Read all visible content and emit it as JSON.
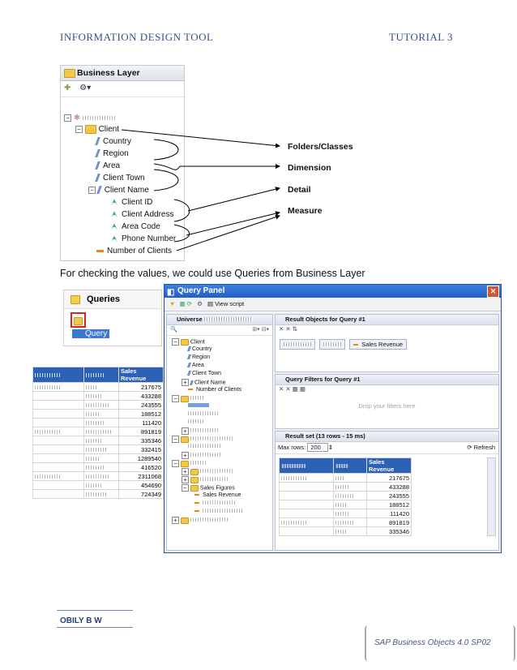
{
  "header": {
    "left": "INFORMATION DESIGN TOOL",
    "right": "TUTORIAL 3"
  },
  "business_layer": {
    "title": "Business Layer",
    "tree": [
      {
        "label": "Client",
        "kind": "folder"
      },
      {
        "label": "Country",
        "kind": "dimension"
      },
      {
        "label": "Region",
        "kind": "dimension"
      },
      {
        "label": "Area",
        "kind": "dimension"
      },
      {
        "label": "Client Town",
        "kind": "dimension"
      },
      {
        "label": "Client Name",
        "kind": "dimension"
      },
      {
        "label": "Client ID",
        "kind": "detail"
      },
      {
        "label": "Client Address",
        "kind": "detail"
      },
      {
        "label": "Area Code",
        "kind": "detail"
      },
      {
        "label": "Phone Number",
        "kind": "detail"
      },
      {
        "label": "Number of Clients",
        "kind": "measure"
      }
    ]
  },
  "callouts": {
    "folders": "Folders/Classes",
    "dimension": "Dimension",
    "detail": "Detail",
    "measure": "Measure"
  },
  "body_text": "For checking the values, we could use Queries from Business Layer",
  "queries_panel": {
    "title": "Queries",
    "item": "Query"
  },
  "left_table": {
    "header": "Sales Revenue",
    "values": [
      "217675",
      "433288",
      "243555",
      "188512",
      "111420",
      "891819",
      "335346",
      "332415",
      "1289540",
      "416520",
      "2311068",
      "454690",
      "724349"
    ]
  },
  "query_panel": {
    "title": "Query Panel",
    "view_script": "View script",
    "universe_label": "Universe",
    "tree": [
      "Client",
      "Country",
      "Region",
      "Area",
      "Client Town",
      "Client Name",
      "Number of Clients",
      "Sales Figures",
      "Sales Revenue"
    ],
    "result_objects_title": "Result Objects for Query #1",
    "result_chip": "Sales Revenue",
    "filters_title": "Query Filters for Query #1",
    "filters_placeholder": "Drop your filters here",
    "result_set_title": "Result set (13 rows - 15 ms)",
    "max_rows_label": "Max rows:",
    "max_rows_value": "200",
    "refresh": "Refresh",
    "result_header": "Sales Revenue",
    "result_values": [
      "217675",
      "433288",
      "243555",
      "188512",
      "111420",
      "891819",
      "335346"
    ]
  },
  "footer": {
    "name": "OBILY B W",
    "product": "SAP Business Objects 4.0 SP02"
  }
}
